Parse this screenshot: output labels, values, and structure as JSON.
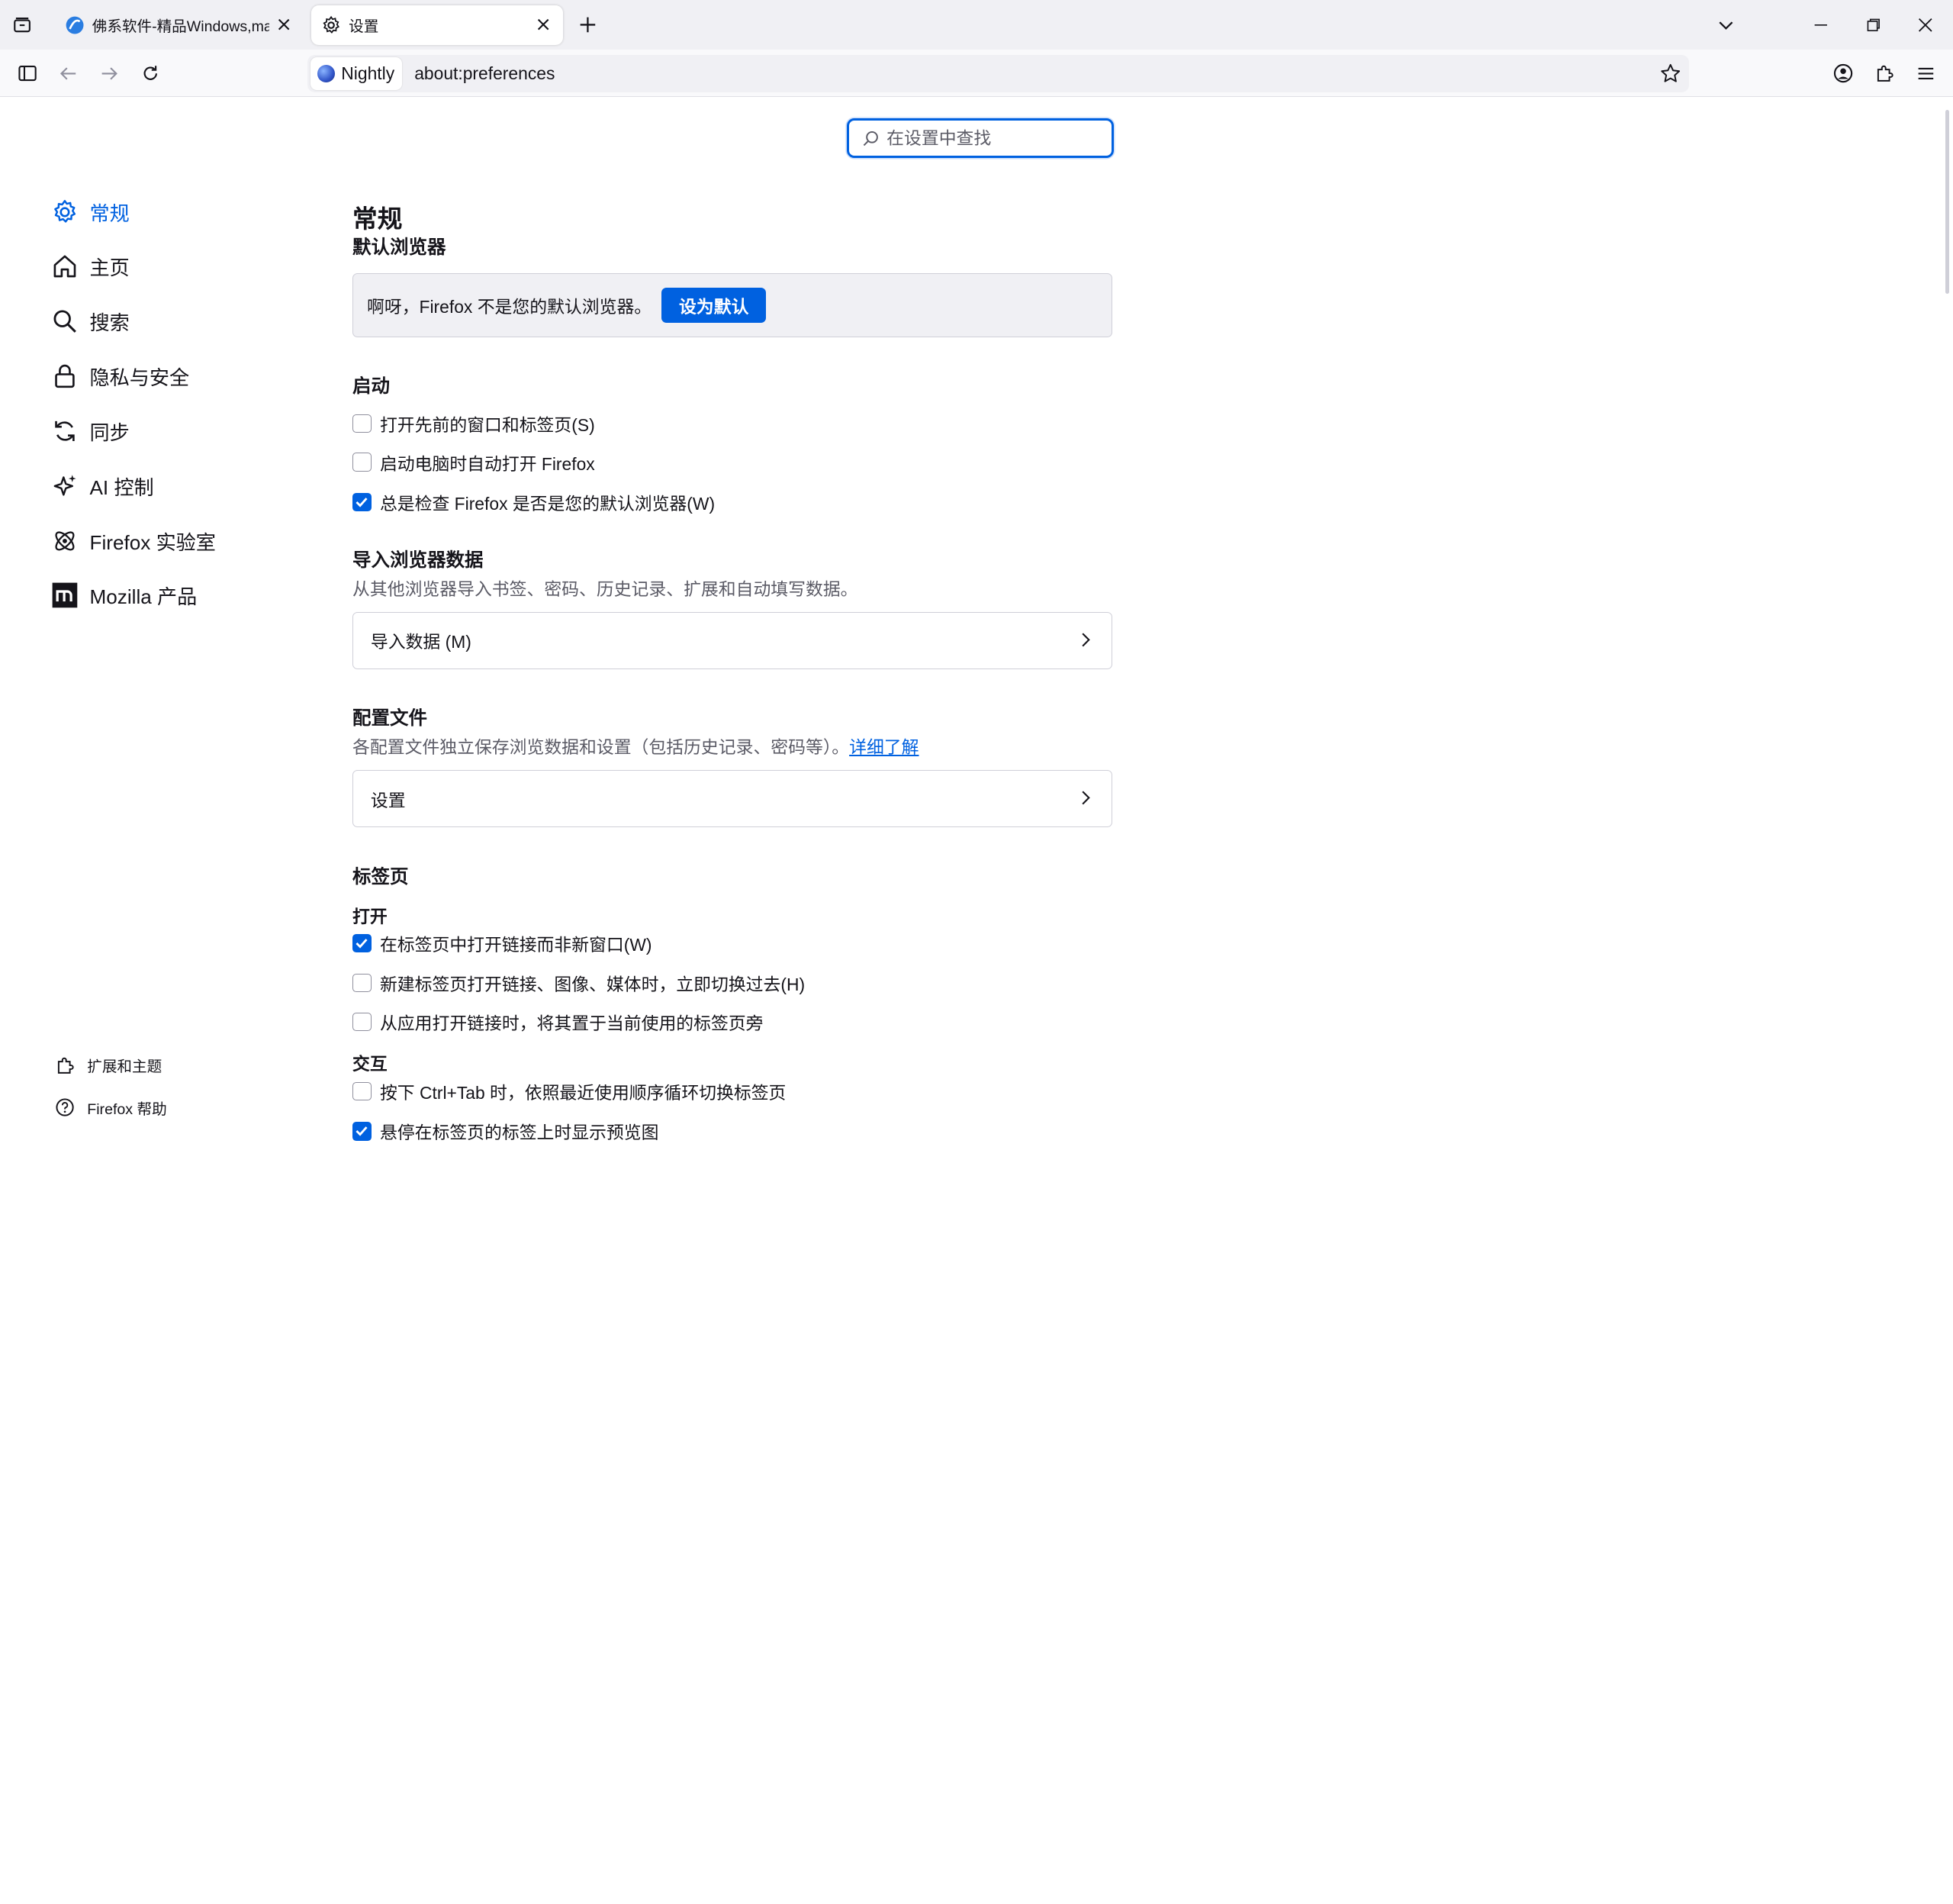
{
  "tabs": [
    {
      "title": "佛系软件-精品Windows,macOS",
      "active": false
    },
    {
      "title": "设置",
      "active": true
    }
  ],
  "urlbar": {
    "identity": "Nightly",
    "url": "about:preferences"
  },
  "search": {
    "placeholder": "在设置中查找"
  },
  "sidebar": {
    "categories": [
      {
        "label": "常规",
        "icon": "gear-icon",
        "selected": true
      },
      {
        "label": "主页",
        "icon": "home-icon"
      },
      {
        "label": "搜索",
        "icon": "search-icon"
      },
      {
        "label": "隐私与安全",
        "icon": "lock-icon"
      },
      {
        "label": "同步",
        "icon": "sync-icon"
      },
      {
        "label": "AI 控制",
        "icon": "sparkle-icon"
      },
      {
        "label": "Firefox 实验室",
        "icon": "labs-icon"
      },
      {
        "label": "Mozilla 产品",
        "icon": "mozilla-icon"
      }
    ],
    "footer": [
      {
        "label": "扩展和主题",
        "icon": "puzzle-icon"
      },
      {
        "label": "Firefox 帮助",
        "icon": "help-icon"
      }
    ]
  },
  "main": {
    "title": "常规",
    "default_browser": {
      "heading": "默认浏览器",
      "message": "啊呀，Firefox 不是您的默认浏览器。",
      "button": "设为默认"
    },
    "startup": {
      "heading": "启动",
      "options": [
        {
          "label": "打开先前的窗口和标签页(S)",
          "checked": false
        },
        {
          "label": "启动电脑时自动打开 Firefox",
          "checked": false
        },
        {
          "label": "总是检查 Firefox 是否是您的默认浏览器(W)",
          "checked": true
        }
      ]
    },
    "import": {
      "heading": "导入浏览器数据",
      "description": "从其他浏览器导入书签、密码、历史记录、扩展和自动填写数据。",
      "button": "导入数据 (M)"
    },
    "profiles": {
      "heading": "配置文件",
      "description": "各配置文件独立保存浏览数据和设置（包括历史记录、密码等）。",
      "link": "详细了解",
      "button": "设置"
    },
    "tabs_section": {
      "heading": "标签页",
      "open_heading": "打开",
      "open_options": [
        {
          "label": "在标签页中打开链接而非新窗口(W)",
          "checked": true
        },
        {
          "label": "新建标签页打开链接、图像、媒体时，立即切换过去(H)",
          "checked": false
        },
        {
          "label": "从应用打开链接时，将其置于当前使用的标签页旁",
          "checked": false
        }
      ],
      "interact_heading": "交互",
      "interact_options": [
        {
          "label": "按下 Ctrl+Tab 时，依照最近使用顺序循环切换标签页",
          "checked": false
        },
        {
          "label": "悬停在标签页的标签上时显示预览图",
          "checked": true
        }
      ]
    }
  }
}
